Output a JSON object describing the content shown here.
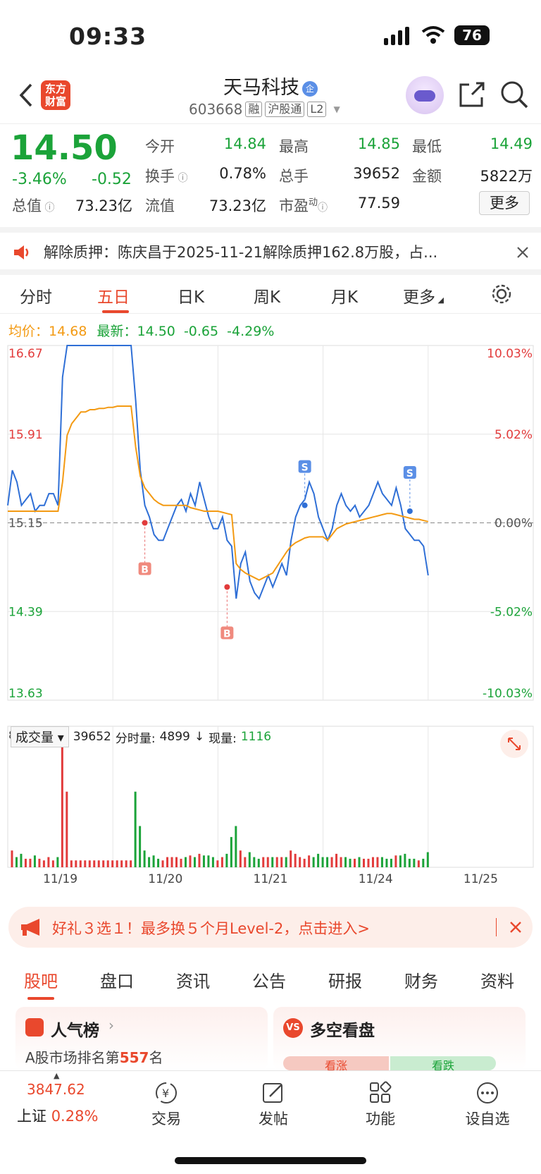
{
  "status": {
    "time": "09:33",
    "battery": "76"
  },
  "header": {
    "logo_line1": "东方",
    "logo_line2": "财富",
    "name": "天马科技",
    "name_badge": "企",
    "code": "603668",
    "tags": [
      "融",
      "沪股通",
      "L2"
    ]
  },
  "quote": {
    "price": "14.50",
    "change_pct": "-3.46%",
    "change": "-0.52",
    "fields": [
      {
        "label": "今开",
        "value": "14.84"
      },
      {
        "label": "最高",
        "value": "14.85"
      },
      {
        "label": "最低",
        "value": "14.49"
      },
      {
        "label": "换手",
        "value": "0.78%"
      },
      {
        "label": "总手",
        "value": "39652"
      },
      {
        "label": "金额",
        "value": "5822万"
      },
      {
        "label": "总值",
        "value": "73.23亿"
      },
      {
        "label": "流值",
        "value": "73.23亿"
      },
      {
        "label": "市盈",
        "value": "77.59"
      }
    ],
    "pe_sup": "动",
    "more": "更多"
  },
  "notice": {
    "text": "解除质押：陈庆昌于2025-11-21解除质押162.8万股，占..."
  },
  "tabs": [
    "分时",
    "五日",
    "日K",
    "周K",
    "月K",
    "更多"
  ],
  "avgline": {
    "avg_label": "均价：",
    "avg": "14.68",
    "latest_label": "最新：",
    "latest": "14.50",
    "chg": "-0.65",
    "pct": "-4.29%"
  },
  "chart_data": {
    "type": "line",
    "y_labels_left": [
      "16.67",
      "15.91",
      "15.15",
      "14.39",
      "13.63"
    ],
    "y_labels_right": [
      "10.03%",
      "5.02%",
      "0.00%",
      "-5.02%",
      "-10.03%"
    ],
    "ylim": [
      13.63,
      16.67
    ],
    "base": 15.15,
    "x_labels": [
      "11/19",
      "11/20",
      "11/21",
      "11/24",
      "11/25"
    ],
    "series": [
      {
        "name": "price",
        "values": [
          15.3,
          15.6,
          15.5,
          15.3,
          15.35,
          15.4,
          15.25,
          15.3,
          15.3,
          15.4,
          15.4,
          15.3,
          16.4,
          16.67,
          16.67,
          16.67,
          16.67,
          16.67,
          16.67,
          16.67,
          16.67,
          16.67,
          16.67,
          16.67,
          16.67,
          16.67,
          16.67,
          16.67,
          16.2,
          15.6,
          15.3,
          15.2,
          15.05,
          15.0,
          15.0,
          15.1,
          15.2,
          15.3,
          15.35,
          15.25,
          15.4,
          15.3,
          15.5,
          15.35,
          15.2,
          15.1,
          15.1,
          15.2,
          15.0,
          14.95,
          14.5,
          14.8,
          14.9,
          14.65,
          14.55,
          14.5,
          14.6,
          14.7,
          14.6,
          14.7,
          14.8,
          14.7,
          15.0,
          15.2,
          15.3,
          15.35,
          15.5,
          15.4,
          15.2,
          15.1,
          15.0,
          15.1,
          15.3,
          15.4,
          15.3,
          15.25,
          15.3,
          15.2,
          15.25,
          15.3,
          15.4,
          15.5,
          15.4,
          15.35,
          15.3,
          15.45,
          15.3,
          15.1,
          15.05,
          15.0,
          15.0,
          14.95,
          14.7
        ]
      },
      {
        "name": "avg",
        "values": [
          15.25,
          15.25,
          15.25,
          15.25,
          15.25,
          15.25,
          15.25,
          15.25,
          15.25,
          15.25,
          15.25,
          15.25,
          15.5,
          15.9,
          16.0,
          16.05,
          16.1,
          16.1,
          16.12,
          16.12,
          16.13,
          16.13,
          16.14,
          16.14,
          16.15,
          16.15,
          16.15,
          16.15,
          15.8,
          15.55,
          15.45,
          15.4,
          15.35,
          15.32,
          15.3,
          15.3,
          15.3,
          15.3,
          15.3,
          15.3,
          15.28,
          15.27,
          15.26,
          15.25,
          15.25,
          15.25,
          15.25,
          15.24,
          15.23,
          15.22,
          14.8,
          14.75,
          14.72,
          14.7,
          14.68,
          14.66,
          14.68,
          14.7,
          14.72,
          14.78,
          14.84,
          14.9,
          14.95,
          14.98,
          15.0,
          15.02,
          15.03,
          15.03,
          15.03,
          15.03,
          15.0,
          15.05,
          15.1,
          15.12,
          15.14,
          15.15,
          15.16,
          15.17,
          15.18,
          15.19,
          15.2,
          15.21,
          15.22,
          15.23,
          15.23,
          15.22,
          15.21,
          15.2,
          15.19,
          15.18,
          15.18,
          15.17,
          15.16
        ]
      }
    ],
    "markers": [
      {
        "type": "B",
        "value": 15.15
      },
      {
        "type": "B",
        "value": 14.6
      },
      {
        "type": "S",
        "value": 15.3
      },
      {
        "type": "S",
        "value": 15.25
      }
    ],
    "volume": {
      "label": "成交量",
      "total": "39652",
      "fen_label": "分时量:",
      "fen": "4899",
      "xian_label": "现量:",
      "xian": "1116",
      "max": "87075"
    }
  },
  "promo": {
    "text": "好礼３选１！最多换５个月Level-2，点击进入>"
  },
  "bottom_tabs": [
    "股吧",
    "盘口",
    "资讯",
    "公告",
    "研报",
    "财务",
    "资料"
  ],
  "cards": {
    "left_title": "人气榜",
    "left_sub": "A股市场排名第",
    "left_rank": "557",
    "left_suffix": "名",
    "right_title": "多空看盘",
    "right_up": "看涨",
    "right_down": "看跌"
  },
  "nav": {
    "index_value": "3847.62",
    "index_name": "上证",
    "index_pct": "0.28%",
    "items": [
      "交易",
      "发帖",
      "功能",
      "设自选"
    ]
  }
}
